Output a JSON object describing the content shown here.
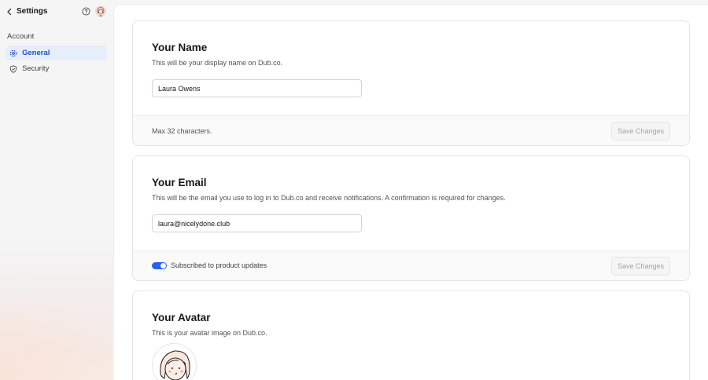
{
  "sidebar": {
    "title": "Settings",
    "section_label": "Account",
    "items": [
      {
        "label": "General",
        "icon": "gear-icon",
        "active": true
      },
      {
        "label": "Security",
        "icon": "shield-check-icon",
        "active": false
      }
    ]
  },
  "name_card": {
    "title": "Your Name",
    "description": "This will be your display name on Dub.co.",
    "input_value": "Laura Owens",
    "footer_note": "Max 32 characters.",
    "save_label": "Save Changes"
  },
  "email_card": {
    "title": "Your Email",
    "description": "This will be the email you use to log in to Dub.co and receive notifications. A confirmation is required for changes.",
    "input_value": "laura@nicelydone.club",
    "toggle_label": "Subscribed to product updates",
    "toggle_on": true,
    "save_label": "Save Changes"
  },
  "avatar_card": {
    "title": "Your Avatar",
    "description": "This is your avatar image on Dub.co."
  },
  "colors": {
    "accent": "#2563eb",
    "active_bg": "#e7eefb",
    "active_text": "#1d4ed8"
  }
}
